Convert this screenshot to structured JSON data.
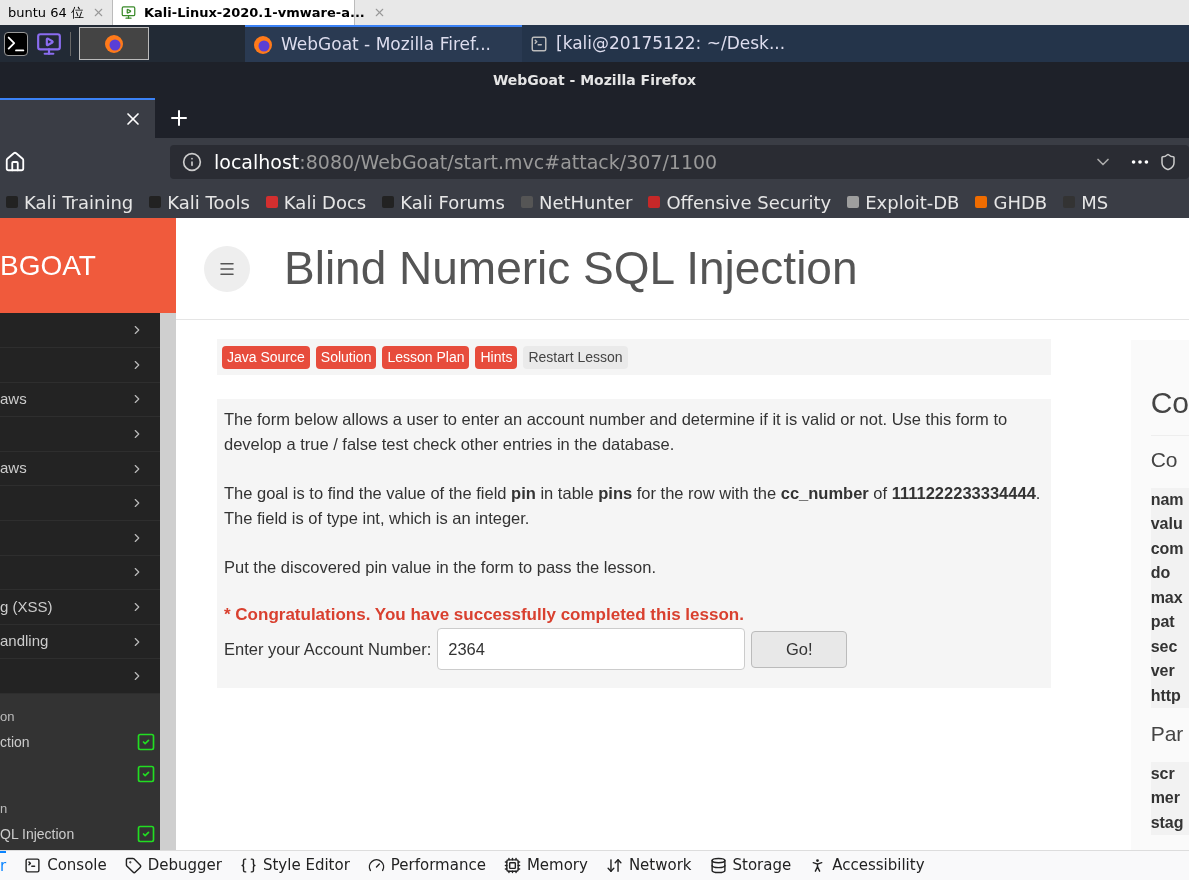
{
  "vm_tabs": [
    {
      "label": "buntu 64 位",
      "selected": false
    },
    {
      "label": "Kali-Linux-2020.1-vmware-a...",
      "selected": true
    }
  ],
  "taskbar": {
    "tasks": [
      {
        "label": "WebGoat - Mozilla Firef...",
        "selected": true,
        "kind": "browser"
      },
      {
        "label": "[kali@20175122: ~/Desk...",
        "selected": false,
        "kind": "terminal"
      }
    ]
  },
  "window": {
    "title": "WebGoat - Mozilla Firefox"
  },
  "url_bar": {
    "host": "localhost",
    "path": ":8080/WebGoat/start.mvc#attack/307/1100"
  },
  "bookmarks": [
    {
      "label": "Kali Training",
      "kind": "kali"
    },
    {
      "label": "Kali Tools",
      "kind": "kali"
    },
    {
      "label": "Kali Docs",
      "kind": "docs"
    },
    {
      "label": "Kali Forums",
      "kind": "kali"
    },
    {
      "label": "NetHunter",
      "kind": "nethunter"
    },
    {
      "label": "Offensive Security",
      "kind": "offsec"
    },
    {
      "label": "Exploit-DB",
      "kind": "exploit"
    },
    {
      "label": "GHDB",
      "kind": "ghdb"
    },
    {
      "label": "MS",
      "kind": "ms"
    }
  ],
  "logo": "BGOAT",
  "sidebar": {
    "categories": [
      {
        "expanded": false
      },
      {
        "expanded": false
      },
      {
        "label": "aws",
        "expanded": false
      },
      {
        "expanded": false
      },
      {
        "label": "aws",
        "expanded": false
      },
      {
        "expanded": false
      },
      {
        "expanded": false
      },
      {
        "expanded": false
      },
      {
        "label": "g (XSS)",
        "expanded": false
      },
      {
        "label": "andling",
        "expanded": false
      },
      {
        "expanded": false
      }
    ],
    "lessons": [
      {
        "kind": "header",
        "label": "on"
      },
      {
        "kind": "lesson",
        "label": "ction",
        "completed": true
      },
      {
        "kind": "lesson",
        "completed": true
      },
      {
        "kind": "header",
        "label": "n"
      },
      {
        "kind": "lesson",
        "label": "QL Injection",
        "completed": true
      }
    ]
  },
  "page_title": "Blind Numeric SQL Injection",
  "lesson_buttons": [
    {
      "label": "Java Source",
      "kind": "primary"
    },
    {
      "label": "Solution",
      "kind": "primary"
    },
    {
      "label": "Lesson Plan",
      "kind": "primary"
    },
    {
      "label": "Hints",
      "kind": "primary"
    },
    {
      "label": "Restart Lesson",
      "kind": "plain"
    }
  ],
  "paragraphs": [
    "The form below allows a user to enter an account number and determine if it is valid or not. Use this form to develop a true / false test check other entries in the database.",
    "The goal is to find the value of the field **pin** in table **pins** for the row with the **cc_number** of **1111222233334444**. The field is of type int, which is an integer.",
    "Put the discovered pin value in the form to pass the lesson."
  ],
  "success_message": "* Congratulations. You have successfully completed this lesson.",
  "form": {
    "label": "Enter your Account Number:",
    "value": "2364",
    "button": "Go!"
  },
  "right_panel": {
    "title": "Co",
    "cookies_heading": "Co",
    "cookie_rows": [
      "nam",
      "valu",
      "com",
      "do",
      "max",
      "pat",
      "sec",
      "ver",
      "http"
    ],
    "params_heading": "Par",
    "param_rows": [
      "scr",
      "mer",
      "stag"
    ]
  },
  "devtools_tabs": [
    {
      "label": "r",
      "selected": true,
      "kind": "inspector"
    },
    {
      "label": "Console",
      "selected": false,
      "kind": "console"
    },
    {
      "label": "Debugger",
      "selected": false,
      "kind": "debugger"
    },
    {
      "label": "Style Editor",
      "selected": false,
      "kind": "style"
    },
    {
      "label": "Performance",
      "selected": false,
      "kind": "performance"
    },
    {
      "label": "Memory",
      "selected": false,
      "kind": "memory"
    },
    {
      "label": "Network",
      "selected": false,
      "kind": "network"
    },
    {
      "label": "Storage",
      "selected": false,
      "kind": "storage"
    },
    {
      "label": "Accessibility",
      "selected": false,
      "kind": "accessibility"
    }
  ]
}
